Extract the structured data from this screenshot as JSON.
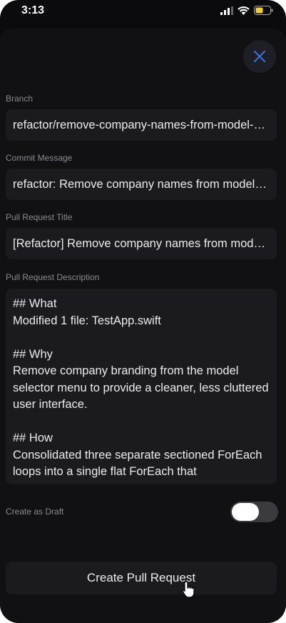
{
  "status": {
    "time": "3:13"
  },
  "icons": {
    "close": "close-icon",
    "cursor": "pointer-cursor-icon"
  },
  "form": {
    "branch": {
      "label": "Branch",
      "value": "refactor/remove-company-names-from-model-selector"
    },
    "commit": {
      "label": "Commit Message",
      "value": "refactor: Remove company names from model selector"
    },
    "pr_title": {
      "label": "Pull Request Title",
      "value": "[Refactor] Remove company names from model selector"
    },
    "pr_description": {
      "label": "Pull Request Description",
      "value": "## What\nModified 1 file: TestApp.swift\n\n## Why\nRemove company branding from the model selector menu to provide a cleaner, less cluttered user interface.\n\n## How\nConsolidated three separate sectioned ForEach loops into a single flat ForEach that"
    },
    "draft": {
      "label": "Create as Draft",
      "enabled": false
    },
    "submit_label": "Create Pull Request"
  },
  "colors": {
    "background": "#0b0b0d",
    "field": "#1b1b1f",
    "accent": "#3b6fd8",
    "battery": "#f2d12e"
  }
}
